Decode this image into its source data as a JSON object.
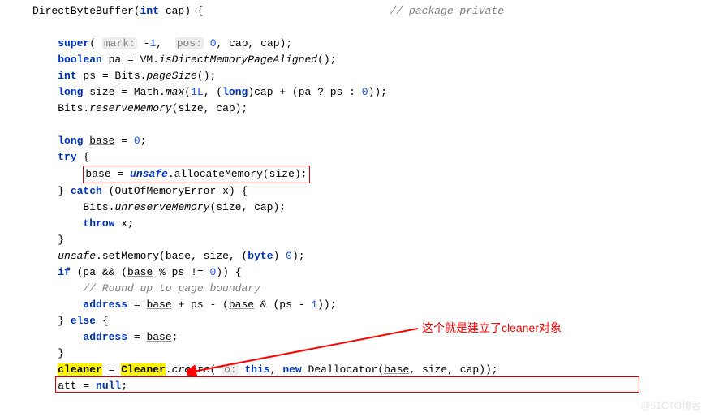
{
  "code": {
    "l1a": "DirectByteBuffer(",
    "l1_kw": "int",
    "l1b": " cap) {",
    "l1_comment": "// package-private",
    "l2_kw": "super",
    "l2a": "( ",
    "l2_hint1": "mark:",
    "l2b": " -",
    "l2_n1": "1",
    "l2c": ",  ",
    "l2_hint2": "pos:",
    "l2d": " ",
    "l2_n2": "0",
    "l2e": ", cap, cap);",
    "l3_kw": "boolean",
    "l3a": " pa = VM.",
    "l3_fn": "isDirectMemoryPageAligned",
    "l3b": "();",
    "l4_kw": "int",
    "l4a": " ps = Bits.",
    "l4_fn": "pageSize",
    "l4b": "();",
    "l5_kw": "long",
    "l5a": " size = Math.",
    "l5_fn": "max",
    "l5b": "(",
    "l5_n1": "1L",
    "l5c": ", (",
    "l5_kw2": "long",
    "l5d": ")cap + (pa ? ps : ",
    "l5_n2": "0",
    "l5e": "));",
    "l6a": "Bits.",
    "l6_fn": "reserveMemory",
    "l6b": "(size, cap);",
    "l7_kw": "long",
    "l7a": " ",
    "l7_base": "base",
    "l7b": " = ",
    "l7_n": "0",
    "l7c": ";",
    "l8_kw": "try",
    "l8a": " {",
    "l9_base": "base",
    "l9a": " = ",
    "l9_unsafe": "unsafe",
    "l9b": ".allocateMemory(size);",
    "l10a": "} ",
    "l10_kw": "catch",
    "l10b": " (OutOfMemoryError x) {",
    "l11a": "Bits.",
    "l11_fn": "unreserveMemory",
    "l11b": "(size, cap);",
    "l12_kw": "throw",
    "l12a": " x;",
    "l13": "}",
    "l14_unsafe": "unsafe",
    "l14a": ".setMemory(",
    "l14_base": "base",
    "l14b": ", size, (",
    "l14_kw": "byte",
    "l14c": ") ",
    "l14_n": "0",
    "l14d": ");",
    "l15_kw": "if",
    "l15a": " (pa && (",
    "l15_base": "base",
    "l15b": " % ps != ",
    "l15_n": "0",
    "l15c": ")) {",
    "l16_comment": "// Round up to page boundary",
    "l17_addr": "address",
    "l17a": " = ",
    "l17_base1": "base",
    "l17b": " + ps - (",
    "l17_base2": "base",
    "l17c": " & (ps - ",
    "l17_n": "1",
    "l17d": "));",
    "l18a": "} ",
    "l18_kw": "else",
    "l18b": " {",
    "l19_addr": "address",
    "l19a": " = ",
    "l19_base": "base",
    "l19b": ";",
    "l20": "}",
    "l21_cleaner": "cleaner",
    "l21a": " = ",
    "l21_Cleaner": "Cleaner",
    "l21b": ".",
    "l21_fn": "create",
    "l21c": "( ",
    "l21_hint": "o:",
    "l21d": " ",
    "l21_kw1": "this",
    "l21e": ", ",
    "l21_kw2": "new",
    "l21f": " Deallocator(",
    "l21_base": "base",
    "l21g": ", size, cap));",
    "l22a": "att = ",
    "l22_kw": "null",
    "l22b": ";"
  },
  "annotation": "这个就是建立了cleaner对象",
  "watermark": "@51CTO博客"
}
